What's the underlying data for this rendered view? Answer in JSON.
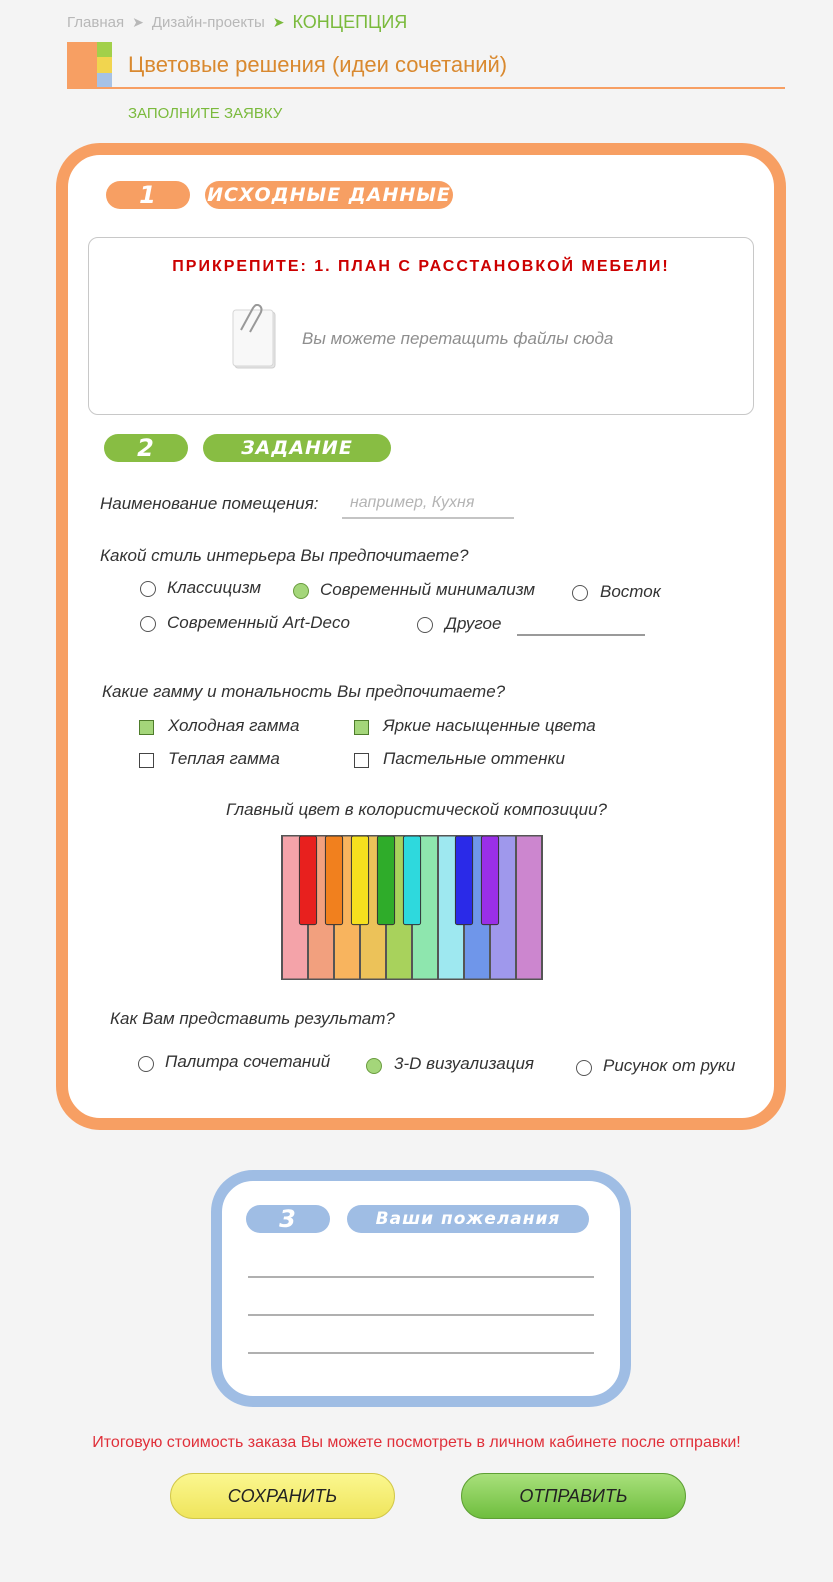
{
  "breadcrumb": {
    "home": "Главная",
    "projects": "Дизайн-проекты",
    "current": "КОНЦЕПЦИЯ",
    "separator": "➤"
  },
  "page": {
    "title": "Цветовые решения (идеи сочетаний)",
    "fill_link": "ЗАПОЛНИТЕ ЗАЯВКУ"
  },
  "section1": {
    "number": "1",
    "label": "Исходные данные",
    "upload_title": "ПРИКРЕПИТЕ: 1. ПЛАН С РАССТАНОВКОЙ МЕБЕЛИ!",
    "upload_hint": "Вы можете перетащить файлы сюда",
    "upload_icon": "paperclip-document-icon"
  },
  "section2": {
    "number": "2",
    "label": "Задание",
    "room_question": "Наименование помещения:",
    "room_placeholder": "например, Кухня",
    "style_question": "Какой стиль интерьера Вы предпочитаете?",
    "style_options": [
      {
        "label": "Классицизм",
        "selected": false
      },
      {
        "label": "Современный минимализм",
        "selected": true
      },
      {
        "label": "Восток",
        "selected": false
      },
      {
        "label": "Современный Art-Deco",
        "selected": false
      },
      {
        "label": "Другое",
        "selected": false
      }
    ],
    "tone_question": "Какие гамму и тональность Вы предпочитаете?",
    "tone_options": [
      {
        "label": "Холодная гамма",
        "checked": true
      },
      {
        "label": "Яркие насыщенные цвета",
        "checked": true
      },
      {
        "label": "Теплая гамма",
        "checked": false
      },
      {
        "label": "Пастельные оттенки",
        "checked": false
      }
    ],
    "main_color_question": "Главный цвет в колористической композиции?",
    "piano_white_keys": [
      "#f4a3a9",
      "#f2a07e",
      "#f8b45e",
      "#ecc259",
      "#a8d25c",
      "#8ee6ae",
      "#9ee8f0",
      "#6f96ea",
      "#9f98ec",
      "#cc86cf"
    ],
    "piano_black_keys": [
      "#e8201e",
      "#f1801e",
      "#f5e01e",
      "#2fac2a",
      "#2ed9dd",
      "#2a2ae8",
      "#9a2fe8"
    ],
    "result_question": "Как Вам представить результат?",
    "result_options": [
      {
        "label": "Палитра сочетаний",
        "selected": false
      },
      {
        "label": "3-D визуализация",
        "selected": true
      },
      {
        "label": "Рисунок от руки",
        "selected": false
      }
    ]
  },
  "section3": {
    "number": "3",
    "label": "Ваши пожелания"
  },
  "footer": {
    "note": "Итоговую стоимость заказа Вы можете посмотреть в личном кабинете после отправки!",
    "save_label": "СОХРАНИТЬ",
    "send_label": "ОТПРАВИТЬ"
  },
  "colors": {
    "orange": "#f79f63",
    "green": "#88bd43",
    "blue": "#9fbde4",
    "title": "#d9892f",
    "alert": "#cc0000"
  }
}
